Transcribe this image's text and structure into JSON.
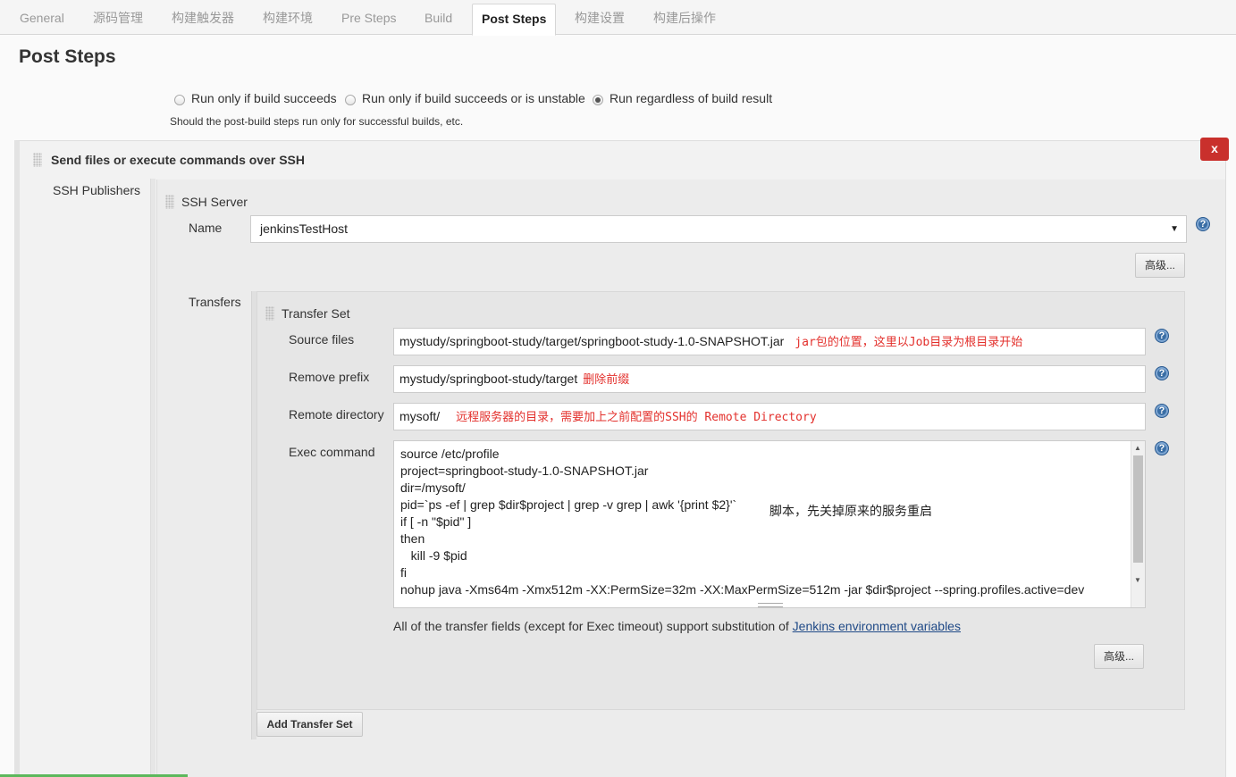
{
  "tabs": [
    {
      "label": "General"
    },
    {
      "label": "源码管理"
    },
    {
      "label": "构建触发器"
    },
    {
      "label": "构建环境"
    },
    {
      "label": "Pre Steps"
    },
    {
      "label": "Build"
    },
    {
      "label": "Post Steps"
    },
    {
      "label": "构建设置"
    },
    {
      "label": "构建后操作"
    }
  ],
  "active_tab": "Post Steps",
  "section_title": "Post Steps",
  "post_steps": {
    "options": [
      {
        "label": "Run only if build succeeds",
        "checked": false
      },
      {
        "label": "Run only if build succeeds or is unstable",
        "checked": false
      },
      {
        "label": "Run regardless of build result",
        "checked": true
      }
    ],
    "help_text": "Should the post-build steps run only for successful builds, etc."
  },
  "publisher": {
    "title": "Send files or execute commands over SSH",
    "close_label": "x",
    "publishers_label": "SSH Publishers",
    "server_label": "SSH Server",
    "name_label": "Name",
    "name_value": "jenkinsTestHost",
    "advanced_label": "高级...",
    "transfers_label": "Transfers",
    "transfer_set": {
      "title": "Transfer Set",
      "source_files_label": "Source files",
      "source_files_value": "mystudy/springboot-study/target/springboot-study-1.0-SNAPSHOT.jar",
      "source_files_note": "jar包的位置，这里以Job目录为根目录开始",
      "remove_prefix_label": "Remove prefix",
      "remove_prefix_value": "mystudy/springboot-study/target",
      "remove_prefix_note": "删除前缀",
      "remote_directory_label": "Remote directory",
      "remote_directory_value": "mysoft/",
      "remote_directory_note": "远程服务器的目录，需要加上之前配置的SSH的 Remote Directory",
      "exec_command_label": "Exec command",
      "exec_command_lines": [
        "source /etc/profile",
        "project=springboot-study-1.0-SNAPSHOT.jar",
        "dir=/mysoft/",
        "pid=`ps -ef | grep $dir$project | grep -v grep | awk '{print $2}'`",
        "if [ -n \"$pid\" ]",
        "then",
        "   kill -9 $pid",
        "fi",
        "nohup java -Xms64m -Xmx512m -XX:PermSize=32m -XX:MaxPermSize=512m -jar $dir$project --spring.profiles.active=dev"
      ],
      "exec_command_note": "脚本，先关掉原来的服务重启",
      "env_text": "All of the transfer fields (except for Exec timeout) support substitution of ",
      "env_link": "Jenkins environment variables",
      "advanced_label": "高级..."
    },
    "add_transfer_label": "Add Transfer Set"
  },
  "colors": {
    "close_button": "#c9302c",
    "annotation_red": "#e3302c",
    "link_blue": "#204a87"
  }
}
